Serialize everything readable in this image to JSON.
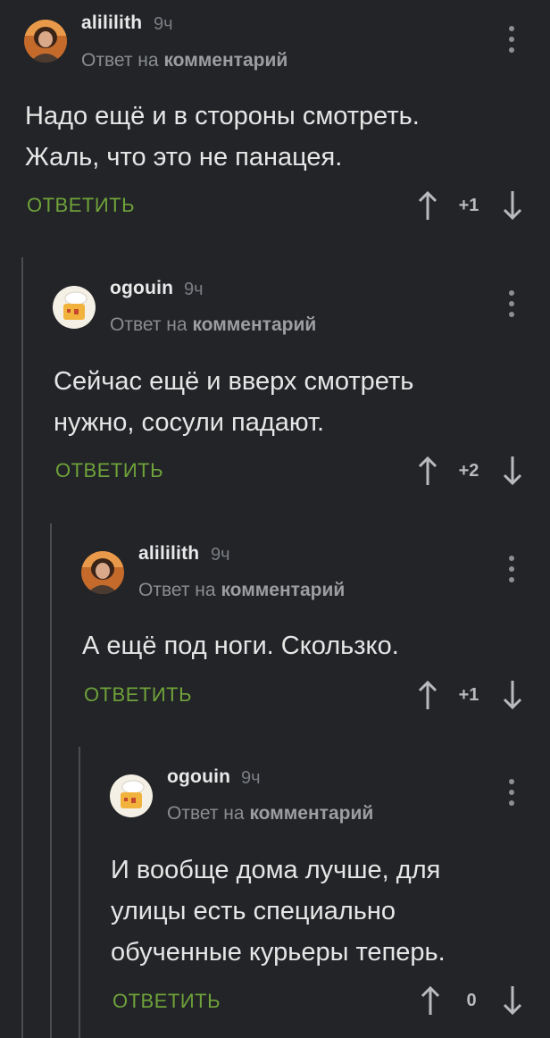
{
  "comments": [
    {
      "username": "alililith",
      "time": "9ч",
      "reply_prefix": "Ответ на",
      "reply_target": "комментарий",
      "lines": [
        "Надо ещё и в стороны смотреть.",
        "Жаль, что это не панацея."
      ],
      "reply_label": "ОТВЕТИТЬ",
      "score": "+1",
      "avatar": "person-avatar"
    },
    {
      "username": "ogouin",
      "time": "9ч",
      "reply_prefix": "Ответ на",
      "reply_target": "комментарий",
      "lines": [
        "Сейчас ещё и вверх смотреть",
        "нужно, сосули падают."
      ],
      "reply_label": "ОТВЕТИТЬ",
      "score": "+2",
      "avatar": "chef-avatar"
    },
    {
      "username": "alililith",
      "time": "9ч",
      "reply_prefix": "Ответ на",
      "reply_target": "комментарий",
      "lines": [
        "А ещё под ноги. Скользко."
      ],
      "reply_label": "ОТВЕТИТЬ",
      "score": "+1",
      "avatar": "person-avatar"
    },
    {
      "username": "ogouin",
      "time": "9ч",
      "reply_prefix": "Ответ на",
      "reply_target": "комментарий",
      "lines": [
        "И вообще дома лучше, для",
        "улицы есть специально",
        "обученные курьеры теперь."
      ],
      "reply_label": "ОТВЕТИТЬ",
      "score": "0",
      "avatar": "chef-avatar"
    }
  ],
  "colors": {
    "background": "#222427",
    "accent_green": "#6fa23a",
    "thread_line": "#4a4c50"
  }
}
